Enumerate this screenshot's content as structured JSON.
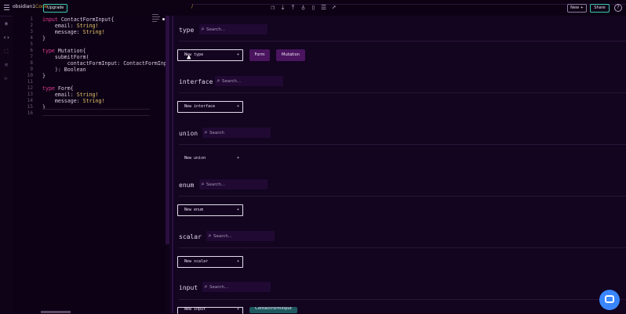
{
  "topbar": {
    "project": "obsidian1",
    "separator": "/",
    "subproject": "Code",
    "upgrade_label": "Upgrade",
    "tools": [
      "copy-icon",
      "download-icon",
      "upload-icon",
      "bulb-icon",
      "book-icon",
      "list-icon",
      "rocket-icon"
    ],
    "new_label": "New +",
    "share_label": "Share",
    "help_label": "?"
  },
  "leftbar": {
    "icons": [
      "eye-icon",
      "code-icon",
      "expand-icon",
      "layers-icon",
      "play-icon"
    ],
    "active_index": 1
  },
  "editor": {
    "line_numbers": [
      "1",
      "2",
      "3",
      "4",
      "5",
      "6",
      "7",
      "8",
      "9",
      "10",
      "11",
      "12",
      "13",
      "14",
      "15",
      "16"
    ],
    "lines": [
      {
        "tokens": [
          {
            "c": "k",
            "t": "input"
          },
          {
            "c": "",
            "t": " ContactFormInput{"
          }
        ]
      },
      {
        "tokens": [
          {
            "c": "",
            "t": "    email"
          },
          {
            "c": "",
            "t": ": "
          },
          {
            "c": "t",
            "t": "String!"
          }
        ]
      },
      {
        "tokens": [
          {
            "c": "",
            "t": "    message"
          },
          {
            "c": "",
            "t": ": "
          },
          {
            "c": "t",
            "t": "String!"
          }
        ]
      },
      {
        "tokens": [
          {
            "c": "",
            "t": "}"
          }
        ]
      },
      {
        "tokens": [
          {
            "c": "",
            "t": ""
          }
        ]
      },
      {
        "tokens": [
          {
            "c": "k",
            "t": "type"
          },
          {
            "c": "",
            "t": " Mutation{"
          }
        ]
      },
      {
        "tokens": [
          {
            "c": "",
            "t": "    submitForm("
          }
        ]
      },
      {
        "tokens": [
          {
            "c": "",
            "t": "        contactFormInput: ContactFormInp"
          }
        ]
      },
      {
        "tokens": [
          {
            "c": "",
            "t": "    ): Boolean"
          }
        ]
      },
      {
        "tokens": [
          {
            "c": "",
            "t": "}"
          }
        ]
      },
      {
        "tokens": [
          {
            "c": "",
            "t": ""
          }
        ]
      },
      {
        "tokens": [
          {
            "c": "k",
            "t": "type"
          },
          {
            "c": "",
            "t": " Form{"
          }
        ]
      },
      {
        "tokens": [
          {
            "c": "",
            "t": "    email"
          },
          {
            "c": "",
            "t": ": "
          },
          {
            "c": "t",
            "t": "String!"
          }
        ]
      },
      {
        "tokens": [
          {
            "c": "",
            "t": "    message"
          },
          {
            "c": "",
            "t": ": "
          },
          {
            "c": "t",
            "t": "String!"
          }
        ]
      },
      {
        "tokens": [
          {
            "c": "",
            "t": "}"
          }
        ]
      },
      {
        "tokens": [
          {
            "c": "",
            "t": ""
          }
        ]
      }
    ]
  },
  "sections": {
    "type": {
      "title": "type",
      "search_placeholder": "Search...",
      "new_label": "New type",
      "plus": "+",
      "tags": [
        "Form",
        "Mutation"
      ]
    },
    "interface": {
      "title": "interface",
      "search_placeholder": "Search...",
      "new_label": "New interface",
      "plus": "+"
    },
    "union": {
      "title": "union",
      "search_placeholder": "Search",
      "new_label": "New union",
      "plus": "+"
    },
    "enum": {
      "title": "enum",
      "search_placeholder": "Search...",
      "new_label": "New enum",
      "plus": "+"
    },
    "scalar": {
      "title": "scalar",
      "search_placeholder": "Search...",
      "new_label": "New scalar",
      "plus": "+"
    },
    "input": {
      "title": "input",
      "search_placeholder": "Search...",
      "new_label": "New input",
      "plus": "+",
      "tags": [
        "ContactFormInput"
      ]
    }
  },
  "colors": {
    "accent_pink": "#e33a93",
    "accent_teal": "#41c6b5",
    "tag_purple": "#4a145f",
    "tag_teal": "#1f5960"
  }
}
